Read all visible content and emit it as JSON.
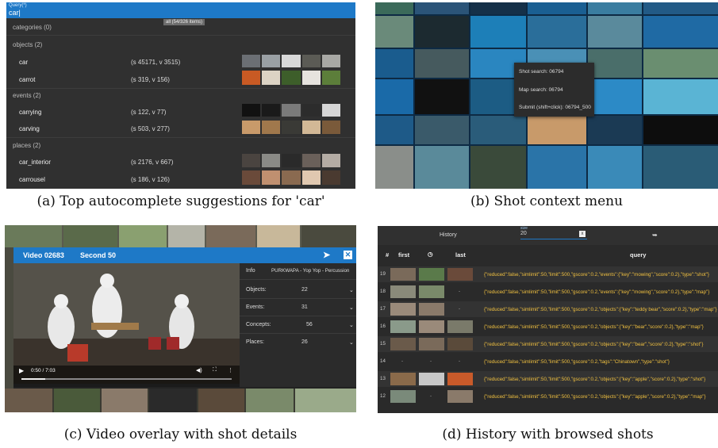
{
  "panel_a": {
    "query_label": "Query(*)",
    "query_value": "car|",
    "hint": "all (54/326 items)",
    "categories_header": "categories (0)",
    "objects_header": "objects (2)",
    "events_header": "events (2)",
    "places_header": "places (2)",
    "items": [
      {
        "name": "car",
        "stat": "(s 45171, v 3515)"
      },
      {
        "name": "carrot",
        "stat": "(s 319, v 156)"
      },
      {
        "name": "carrying",
        "stat": "(s 122, v 77)"
      },
      {
        "name": "carving",
        "stat": "(s 503, v 277)"
      },
      {
        "name": "car_interior",
        "stat": "(s 2176, v 667)"
      },
      {
        "name": "carrousel",
        "stat": "(s 186, v 126)"
      }
    ]
  },
  "panel_b": {
    "menu": [
      "Shot search: 06794",
      "Map search: 06794",
      "Submit (shift+click): 06794_500"
    ]
  },
  "panel_c": {
    "video_label": "Video 02683",
    "second_label": "Second 50",
    "info_label": "Info",
    "info_value": "PURKWAPA - Yop Yop - Percussion",
    "rows": [
      {
        "label": "Objects:",
        "value": "22"
      },
      {
        "label": "Events:",
        "value": "31"
      },
      {
        "label": "Concepts:",
        "value": "56"
      },
      {
        "label": "Places:",
        "value": "26"
      }
    ],
    "time": "0:50 / 7:03"
  },
  "panel_d": {
    "title": "History",
    "size_label": "size",
    "size_value": "20",
    "size_badge": "x",
    "col_hash": "#",
    "col_first": "first",
    "col_last": "last",
    "col_query": "query",
    "rows": [
      {
        "n": "19",
        "q": "{\"reduced\":false,\"simlimit\":50,\"limit\":500,\"gscore\":0.2,\"events\":{\"key\":\"mowing\",\"score\":0.2},\"type\":\"shot\"}"
      },
      {
        "n": "18",
        "q": "{\"reduced\":false,\"simlimit\":50,\"limit\":500,\"gscore\":0.2,\"events\":{\"key\":\"mowing\",\"score\":0.2},\"type\":\"map\"}"
      },
      {
        "n": "17",
        "q": "{\"reduced\":false,\"simlimit\":50,\"limit\":500,\"gscore\":0.2,\"objects\":{\"key\":\"teddy bear\",\"score\":0.2},\"type\":\"map\"}"
      },
      {
        "n": "16",
        "q": "{\"reduced\":false,\"simlimit\":50,\"limit\":500,\"gscore\":0.2,\"objects\":{\"key\":\"bear\",\"score\":0.2},\"type\":\"map\"}"
      },
      {
        "n": "15",
        "q": "{\"reduced\":false,\"simlimit\":50,\"limit\":500,\"gscore\":0.2,\"objects\":{\"key\":\"bear\",\"score\":0.2},\"type\":\"shot\"}"
      },
      {
        "n": "14",
        "q": "{\"reduced\":false,\"simlimit\":50,\"limit\":500,\"gscore\":0.2,\"tags\":\"Chinatown\",\"type\":\"shot\"}"
      },
      {
        "n": "13",
        "q": "{\"reduced\":false,\"simlimit\":50,\"limit\":500,\"gscore\":0.2,\"objects\":{\"key\":\"apple\",\"score\":0.2},\"type\":\"shot\"}"
      },
      {
        "n": "12",
        "q": "{\"reduced\":false,\"simlimit\":50,\"limit\":500,\"gscore\":0.2,\"objects\":{\"key\":\"apple\",\"score\":0.2},\"type\":\"map\"}"
      }
    ]
  },
  "captions": {
    "a": "(a) Top autocomplete suggestions for 'car'",
    "b": "(b) Shot context menu",
    "c": "(c) Video overlay with shot details",
    "d": "(d) History with browsed shots"
  }
}
